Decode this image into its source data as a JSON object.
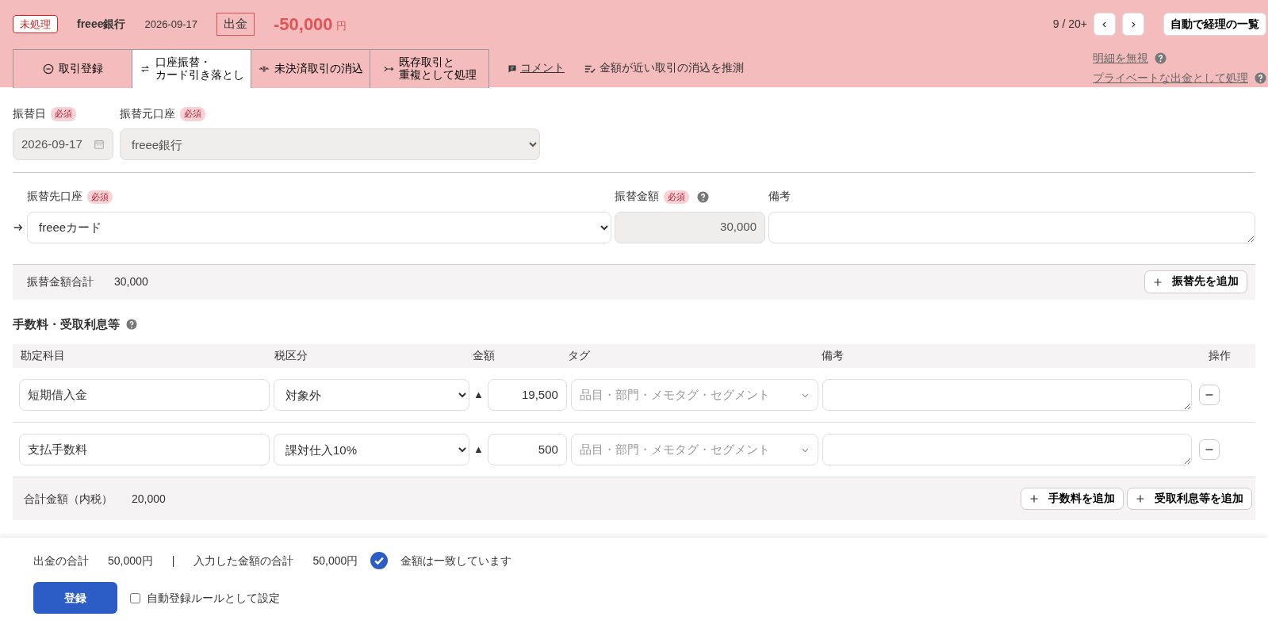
{
  "header": {
    "status": "未処理",
    "account": "freee銀行",
    "date": "2026-09-17",
    "direction": "出金",
    "amount": "-50,000",
    "currency": "円",
    "pager": "9 / 20+",
    "list_button": "自動で経理の一覧"
  },
  "tabs": [
    {
      "lines": [
        "取引登録"
      ],
      "selected": false
    },
    {
      "lines": [
        "口座振替・",
        "カード引き落とし"
      ],
      "selected": true
    },
    {
      "lines": [
        "未決済取引の消込"
      ],
      "selected": false
    },
    {
      "lines": [
        "既存取引と",
        "重複として処理"
      ],
      "selected": false
    }
  ],
  "actions": [
    {
      "label": "コメント",
      "kind": "link"
    },
    {
      "label": "金額が近い取引の消込を推測",
      "kind": "plain"
    }
  ],
  "side_links": [
    "明細を無視",
    "プライベートな出金として処理"
  ],
  "source": {
    "date_label": "振替日",
    "date_required": "必須",
    "account_label": "振替元口座",
    "account_required": "必須",
    "date": "2026-09-17",
    "account": "freee銀行"
  },
  "destination": {
    "account_label": "振替先口座",
    "account_required": "必須",
    "amount_label": "振替金額",
    "amount_required": "必須",
    "note_label": "備考",
    "account": "freeeカード",
    "amount": "30,000"
  },
  "transfer_total": {
    "label": "振替金額合計",
    "value": "30,000",
    "add_button": "振替先を追加"
  },
  "fees": {
    "title": "手数料・受取利息等",
    "columns": [
      "勘定科目",
      "税区分",
      "金額",
      "タグ",
      "備考",
      "操作"
    ],
    "rows": [
      {
        "account": "短期借入金",
        "tax": "対象外",
        "sign": "▲",
        "amount": "19,500",
        "tag_placeholder": "品目・部門・メモタグ・セグメント"
      },
      {
        "account": "支払手数料",
        "tax": "課対仕入10%",
        "sign": "▲",
        "amount": "500",
        "tag_placeholder": "品目・部門・メモタグ・セグメント"
      }
    ],
    "total_label": "合計金額（内税）",
    "total": "20,000",
    "buttons": [
      "手数料を追加",
      "受取利息等を追加"
    ]
  },
  "footer": {
    "withdrawal_label": "出金の合計",
    "withdrawal": "50,000円",
    "separator": "|",
    "entered_label": "入力した金額の合計",
    "entered": "50,000円",
    "match": true,
    "match_text": "金額は一致しています",
    "submit": "登録",
    "rule_label": "自動登録ルールとして設定",
    "rule_checked": false
  }
}
